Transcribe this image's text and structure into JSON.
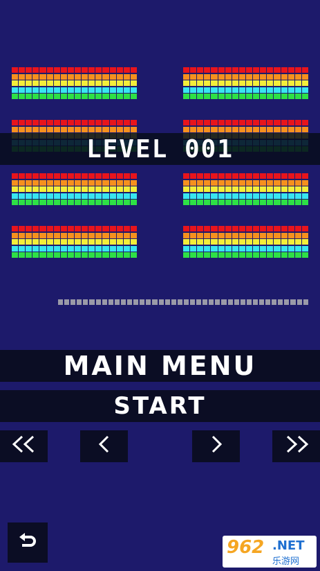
{
  "level": {
    "text": "LEVEL 001"
  },
  "menu": {
    "main_menu_label": "MAIN MENU",
    "start_label": "START"
  },
  "nav": {
    "first_label": "<<",
    "prev_label": "<",
    "next_label": ">",
    "last_label": ">>"
  },
  "back": {
    "icon": "undo-arrow-icon"
  },
  "bricks": {
    "columns_per_row": 18,
    "row_colors": [
      "#e8141c",
      "#f6901e",
      "#f4ee3a",
      "#38e6f0",
      "#2ee046"
    ],
    "group_count": 8
  },
  "progress": {
    "segments": 40,
    "filled": 0
  },
  "watermark": {
    "number": "962",
    "suffix": ".NET",
    "chinese": "乐游网"
  },
  "colors": {
    "background": "#1d1a6b",
    "button_bg": "#0b0d24",
    "text": "#ffffff"
  }
}
